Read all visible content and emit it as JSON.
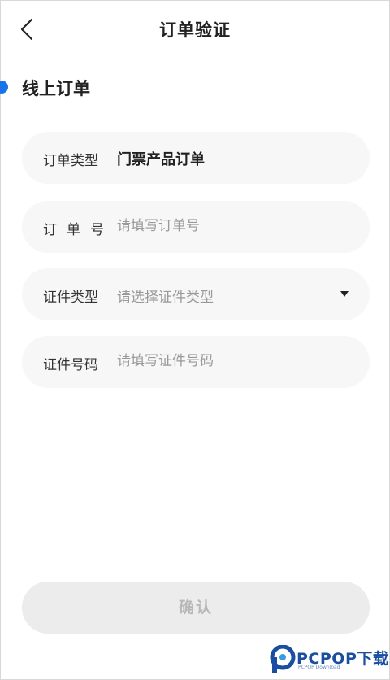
{
  "header": {
    "back_icon": "chevron-left-icon",
    "title": "订单验证"
  },
  "section": {
    "title": "线上订单",
    "accent_color": "#1a73e8"
  },
  "form": {
    "order_type": {
      "label": "订单类型",
      "value": "门票产品订单"
    },
    "order_number": {
      "label": "订单号",
      "placeholder": "请填写订单号",
      "value": ""
    },
    "id_type": {
      "label": "证件类型",
      "placeholder": "请选择证件类型",
      "icon": "caret-down-icon"
    },
    "id_number": {
      "label": "证件号码",
      "placeholder": "请填写证件号码",
      "value": ""
    }
  },
  "confirm_label": "确认",
  "watermark": {
    "brand": "PCPOP下载",
    "sub": "PCPOP Download"
  }
}
